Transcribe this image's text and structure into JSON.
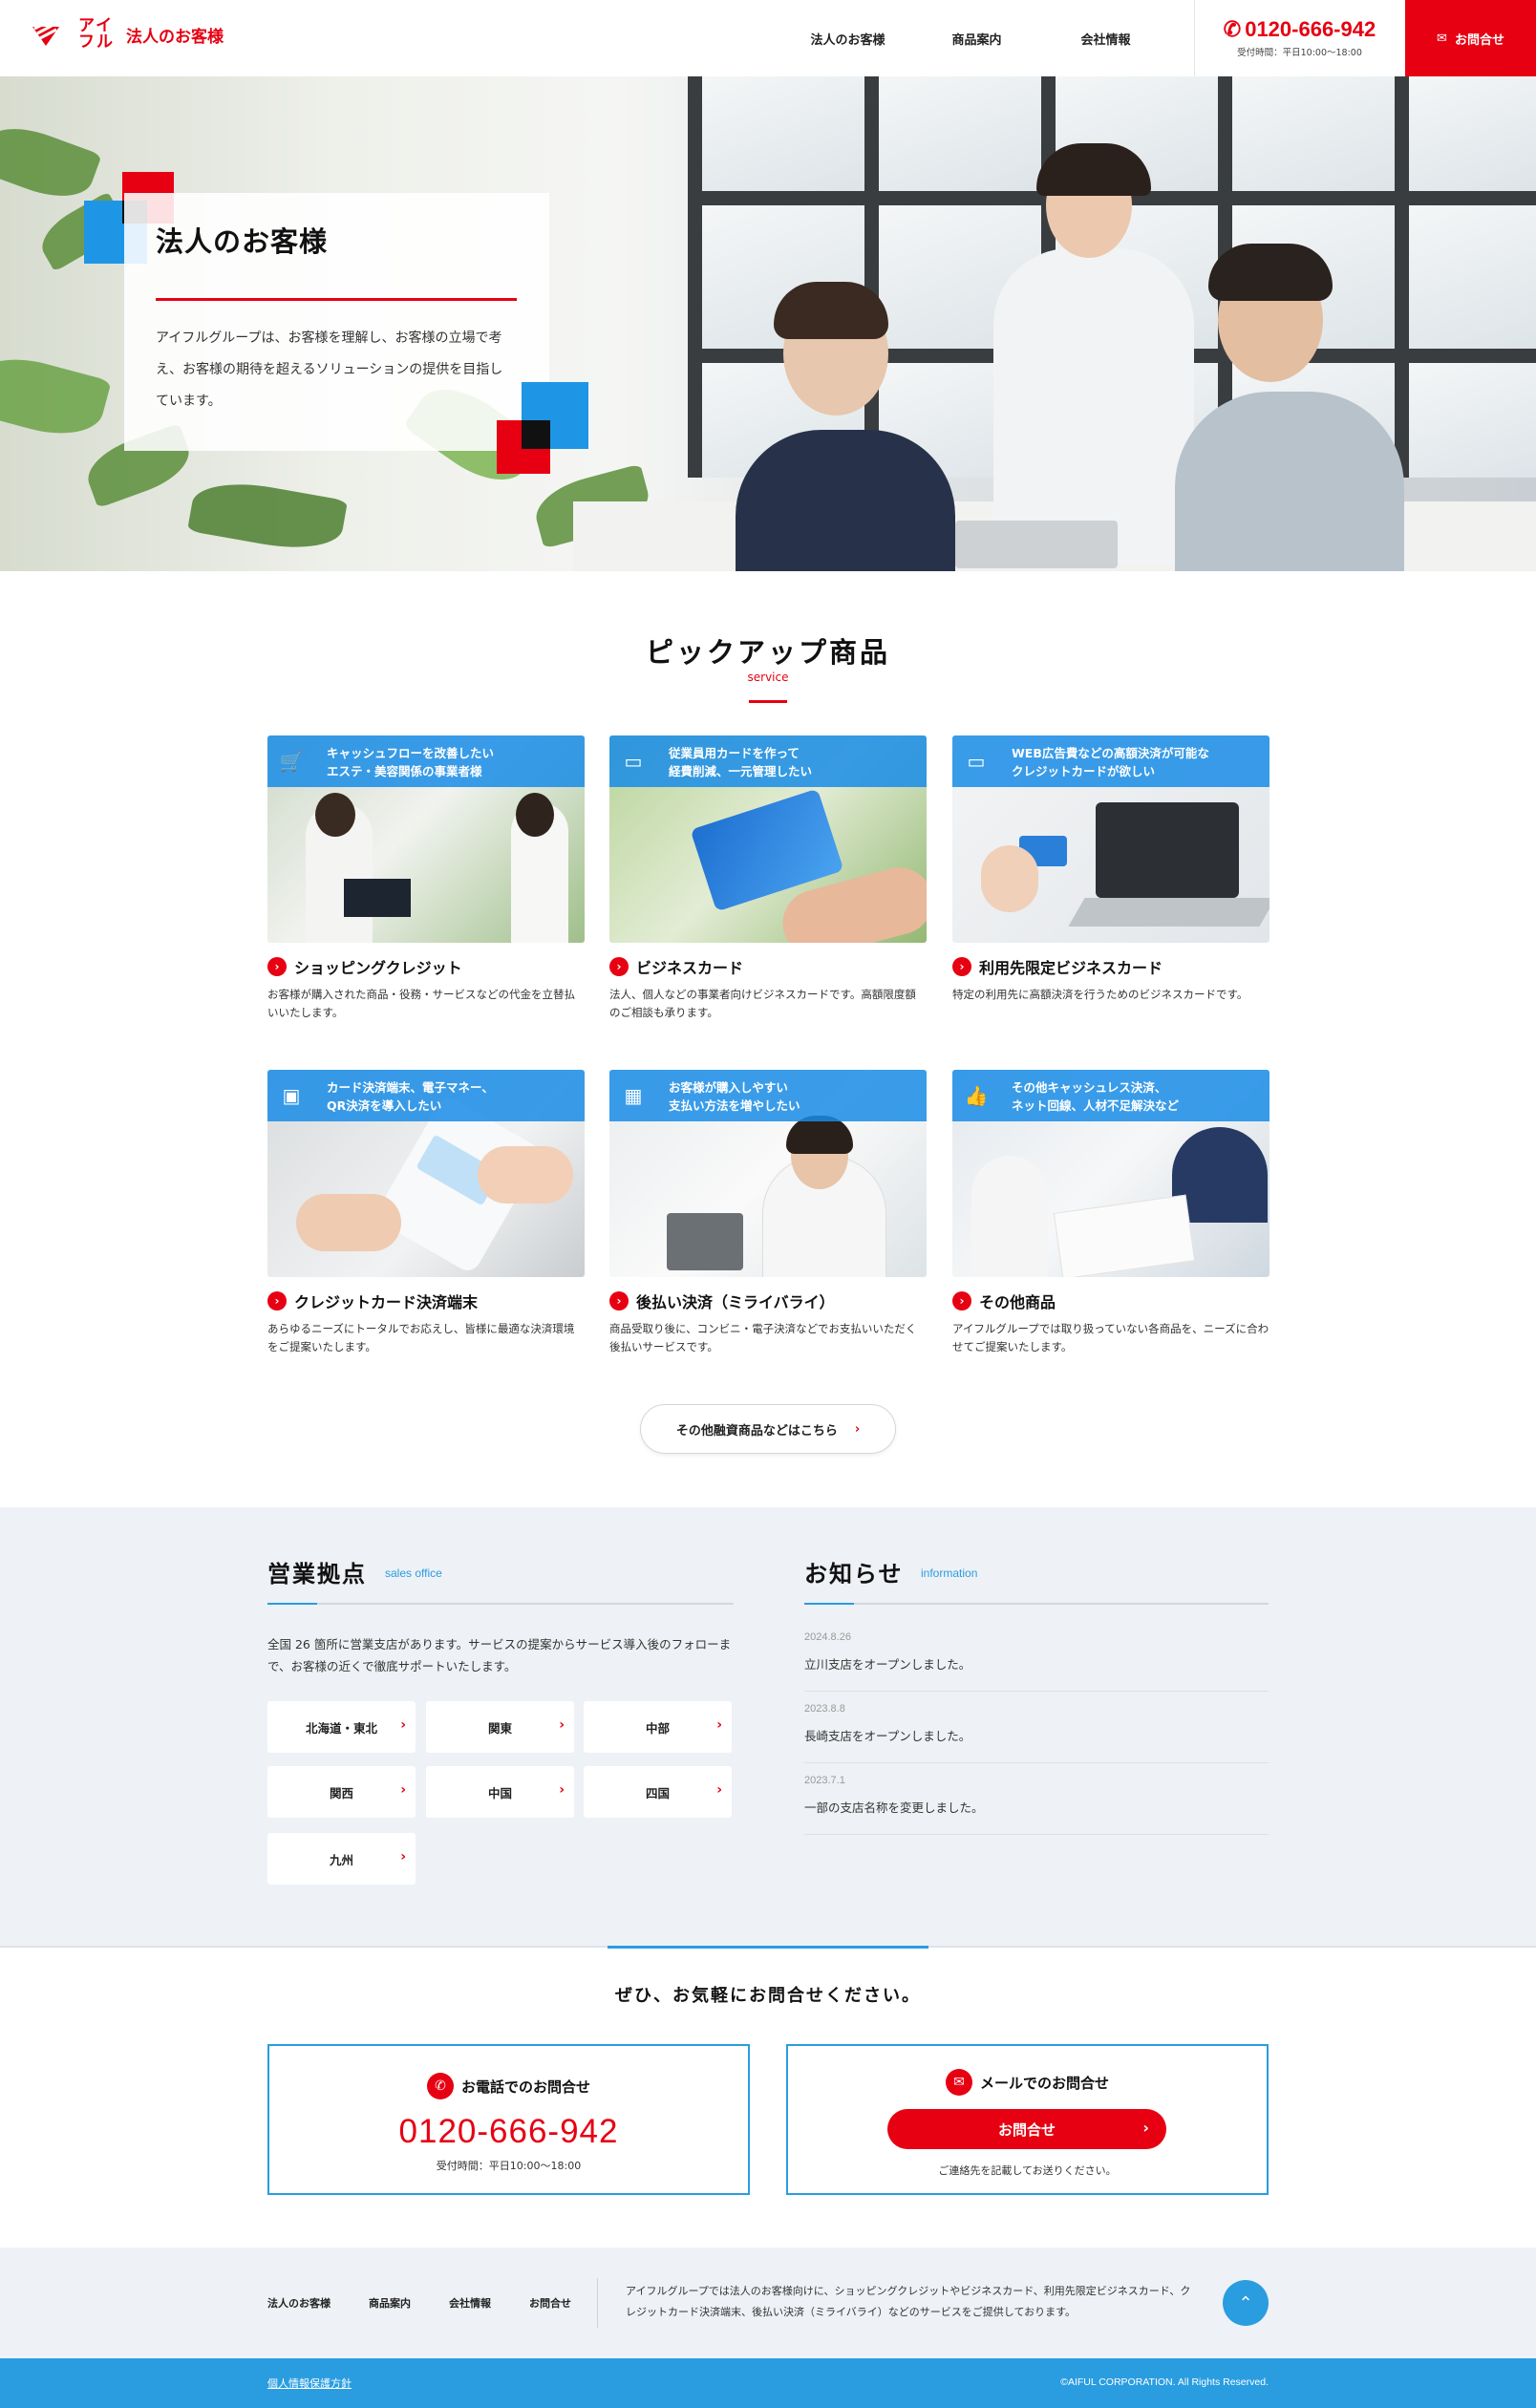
{
  "header": {
    "brand_kana": "アイフル",
    "brand_title": "法人のお客様",
    "nav": [
      "法人のお客様",
      "商品案内",
      "会社情報"
    ],
    "tel": "0120-666-942",
    "tel_hours": "受付時間：平日10:00〜18:00",
    "contact_label": "お問合せ"
  },
  "hero": {
    "title": "法人のお客様",
    "text": "アイフルグループは、お客様を理解し、お客様の立場で考え、お客様の期待を超えるソリューションの提供を目指しています。"
  },
  "pickup": {
    "title": "ピックアップ商品",
    "subtitle": "service",
    "products": [
      {
        "icon": "cart-icon",
        "caption": "キャッシュフローを改善したい\nエステ・美容関係の事業者様",
        "name": "ショッピングクレジット",
        "desc": "お客様が購入された商品・役務・サービスなどの代金を立替払いいたします。"
      },
      {
        "icon": "card-icon",
        "caption": "従業員用カードを作って\n経費削減、一元管理したい",
        "name": "ビジネスカード",
        "desc": "法人、個人などの事業者向けビジネスカードです。高額限度額のご相談も承ります。"
      },
      {
        "icon": "card-icon",
        "caption": "WEB広告費などの高額決済が可能な\nクレジットカードが欲しい",
        "name": "利用先限定ビジネスカード",
        "desc": "特定の利用先に高額決済を行うためのビジネスカードです。"
      },
      {
        "icon": "terminal-icon",
        "caption": "カード決済端末、電子マネー、\nQR決済を導入したい",
        "name": "クレジットカード決済端末",
        "desc": "あらゆるニーズにトータルでお応えし、皆様に最適な決済環境をご提案いたします。"
      },
      {
        "icon": "calendar-icon",
        "caption": "お客様が購入しやすい\n支払い方法を増やしたい",
        "name": "後払い決済（ミライバライ）",
        "desc": "商品受取り後に、コンビニ・電子決済などでお支払いいただく後払いサービスです。"
      },
      {
        "icon": "thumbs-up-icon",
        "caption": "その他キャッシュレス決済、\nネット回線、人材不足解決など",
        "name": "その他商品",
        "desc": "アイフルグループでは取り扱っていない各商品を、ニーズに合わせてご提案いたします。"
      }
    ],
    "more_label": "その他融資商品などはこちら"
  },
  "office": {
    "title": "営業拠点",
    "subtitle": "sales office",
    "text": "全国 26 箇所に営業支店があります。サービスの提案からサービス導入後のフォローまで、お客様の近くで徹底サポートいたします。",
    "areas": [
      "北海道・東北",
      "関東",
      "中部",
      "関西",
      "中国",
      "四国",
      "九州"
    ]
  },
  "news": {
    "title": "お知らせ",
    "subtitle": "information",
    "items": [
      {
        "date": "2024.8.26",
        "title": "立川支店をオープンしました。"
      },
      {
        "date": "2023.8.8",
        "title": "長崎支店をオープンしました。"
      },
      {
        "date": "2023.7.1",
        "title": "一部の支店名称を変更しました。"
      }
    ]
  },
  "contact": {
    "lead": "ぜひ、お気軽にお問合せください。",
    "tel_title": "お電話でのお問合せ",
    "tel": "0120-666-942",
    "tel_hours": "受付時間：平日10:00〜18:00",
    "mail_title": "メールでのお問合せ",
    "mail_button": "お問合せ",
    "mail_note": "ご連絡先を記載してお送りください。"
  },
  "footer": {
    "nav": [
      "法人のお客様",
      "商品案内",
      "会社情報",
      "お問合せ"
    ],
    "about": "アイフルグループでは法人のお客様向けに、ショッピングクレジットやビジネスカード、利用先限定ビジネスカード、クレジットカード決済端末、後払い決済（ミライバライ）などのサービスをご提供しております。",
    "privacy": "個人情報保護方針",
    "copyright": "©AIFUL CORPORATION. All Rights Reserved."
  },
  "colors": {
    "brand_red": "#e60012",
    "accent_blue": "#2a9de0",
    "gray_bg": "#eef1f5"
  }
}
